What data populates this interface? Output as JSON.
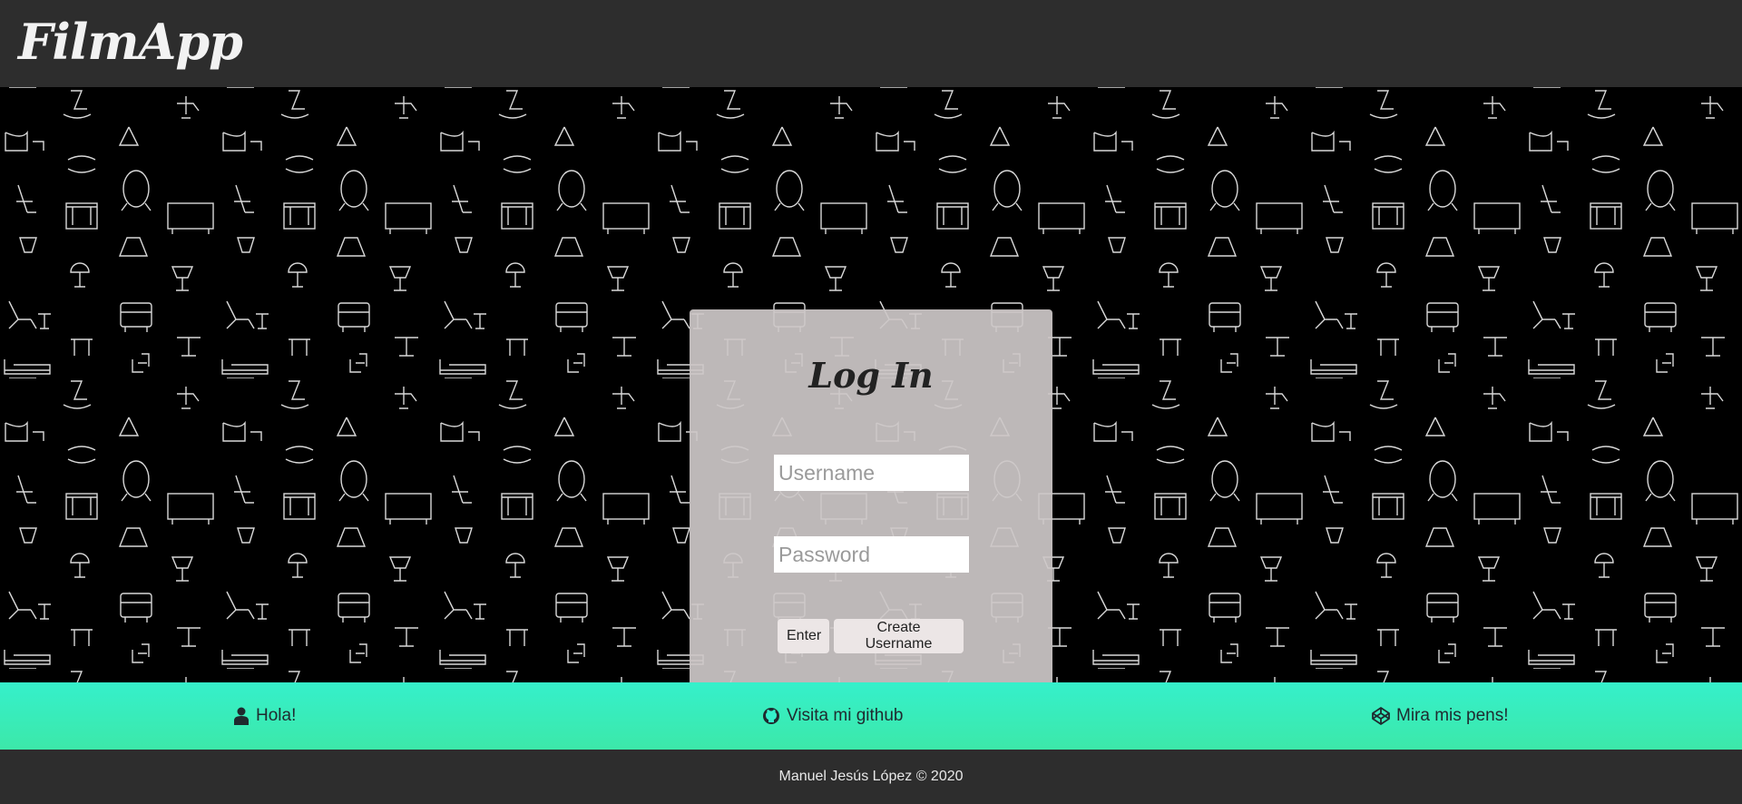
{
  "header": {
    "logo": "FilmApp"
  },
  "login": {
    "title": "Log In",
    "username_placeholder": "Username",
    "password_placeholder": "Password",
    "enter_label": "Enter",
    "create_label": "Create Username"
  },
  "links": {
    "hola": {
      "label": "Hola!",
      "icon": "user-icon"
    },
    "github": {
      "label": "Visita mi github",
      "icon": "github-icon"
    },
    "pens": {
      "label": "Mira mis pens!",
      "icon": "codepen-icon"
    }
  },
  "footer": {
    "text": "Manuel Jesús López © 2020"
  },
  "colors": {
    "topbar": "#2d2d2d",
    "card": "#cdc8c8",
    "links_bar": "#35f0cb",
    "footer": "#2d2d2d"
  }
}
